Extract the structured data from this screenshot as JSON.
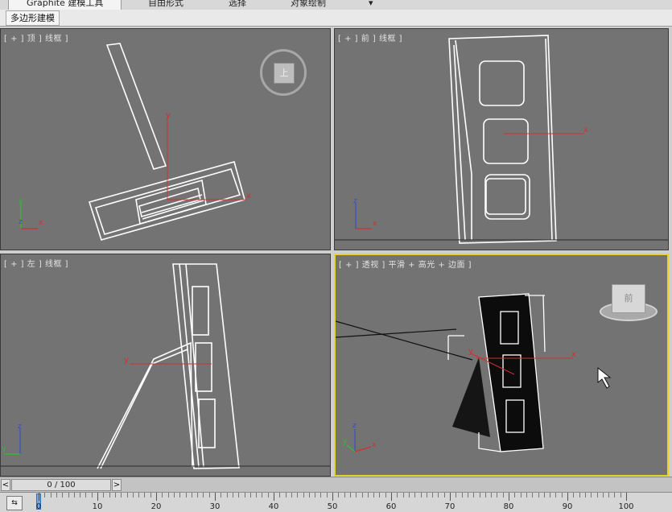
{
  "ribbon": {
    "tabs": [
      {
        "label": "Graphite 建模工具",
        "active": true
      },
      {
        "label": "自由形式",
        "active": false
      },
      {
        "label": "选择",
        "active": false
      },
      {
        "label": "对象绘制",
        "active": false
      },
      {
        "label": "▾",
        "active": false
      }
    ],
    "subtab": "多边形建模"
  },
  "viewports": {
    "top": {
      "label": "[ + ] 顶 ] 线框 ]",
      "cube_face": "上"
    },
    "front": {
      "label": "[ + ] 前 ] 线框 ]"
    },
    "left": {
      "label": "[ + ] 左 ] 线框 ]"
    },
    "persp": {
      "label": "[ + ] 透视 ] 平滑 + 高光 + 边面 ]",
      "cube_face": "前"
    }
  },
  "axes": {
    "x": "x",
    "y": "y",
    "z": "z"
  },
  "timeline": {
    "frame_text": "0 / 100",
    "prev_label": "<",
    "next_label": ">",
    "ticks": [
      "0",
      "10",
      "20",
      "30",
      "40",
      "50",
      "60",
      "70",
      "80",
      "90",
      "100"
    ],
    "ruler_icon": "⇆"
  },
  "colors": {
    "viewport_bg": "#737373",
    "active_border": "#e7d32a",
    "axis_x": "#d23030",
    "axis_y": "#2fbf2f",
    "axis_z": "#3a49d6",
    "wire": "#ffffff"
  }
}
